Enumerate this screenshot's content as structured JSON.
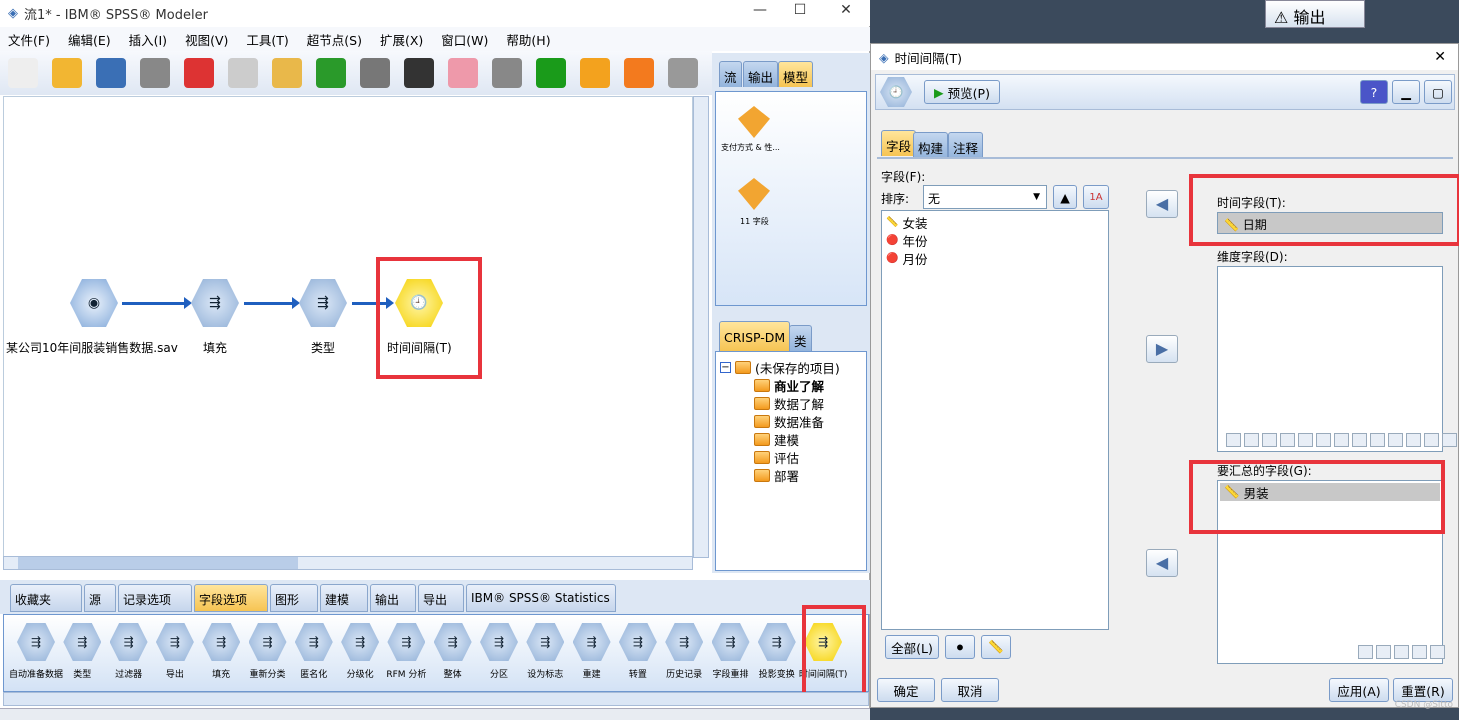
{
  "window": {
    "title": "流1* - IBM® SPSS® Modeler",
    "min": "—",
    "max": "☐",
    "close": "✕"
  },
  "menu": [
    "文件(F)",
    "编辑(E)",
    "插入(I)",
    "视图(V)",
    "工具(T)",
    "超节点(S)",
    "扩展(X)",
    "窗口(W)",
    "帮助(H)"
  ],
  "toolbar_icons": [
    "new-icon",
    "open-icon",
    "save-icon",
    "print-icon",
    "cut-icon",
    "copy-icon",
    "paste-icon",
    "undo-icon",
    "redo-icon",
    "find-icon",
    "edit-icon",
    "stop-icon",
    "run-icon",
    "run-selection-icon",
    "favorite-icon",
    "star-icon"
  ],
  "stream": {
    "nodes": [
      {
        "label": "某公司10年间服装销售数据.sav",
        "icon": "source-icon"
      },
      {
        "label": "填充",
        "icon": "fill-icon"
      },
      {
        "label": "类型",
        "icon": "type-icon"
      },
      {
        "label": "时间间隔(T)",
        "icon": "clock-icon"
      }
    ]
  },
  "manager": {
    "tabs": [
      "流",
      "输出",
      "模型"
    ],
    "active_tab": "模型",
    "models": [
      "支付方式 & 性...",
      "11 字段"
    ]
  },
  "project": {
    "tabs": [
      "CRISP-DM",
      "类"
    ],
    "root": "(未保存的项目)",
    "folders": [
      "商业了解",
      "数据了解",
      "数据准备",
      "建模",
      "评估",
      "部署"
    ]
  },
  "palette": {
    "tabs": [
      "收藏夹",
      "源",
      "记录选项",
      "字段选项",
      "图形",
      "建模",
      "输出",
      "导出",
      "IBM® SPSS® Statistics"
    ],
    "active_tab": "字段选项",
    "items": [
      "自动准备数据",
      "类型",
      "过滤器",
      "导出",
      "填充",
      "重新分类",
      "匿名化",
      "分级化",
      "RFM 分析",
      "整体",
      "分区",
      "设为标志",
      "重建",
      "转置",
      "历史记录",
      "字段重排",
      "投影变换",
      "时间间隔(T)"
    ]
  },
  "dialog": {
    "title": "时间间隔(T)",
    "close": "✕",
    "preview": "预览(P)",
    "tabs": [
      "字段",
      "构建",
      "注释"
    ],
    "active_tab": "字段",
    "fields_label": "字段(F):",
    "sort_label": "排序:",
    "sort_value": "无",
    "fields": [
      {
        "name": "女装",
        "type": "continuous"
      },
      {
        "name": "年份",
        "type": "nominal"
      },
      {
        "name": "月份",
        "type": "nominal"
      }
    ],
    "buttons_left": [
      "全部(L)"
    ],
    "time_field_label": "时间字段(T):",
    "time_field": "日期",
    "dim_label": "维度字段(D):",
    "agg_label": "要汇总的字段(G):",
    "agg_fields": [
      "男装"
    ],
    "ok": "确定",
    "cancel": "取消",
    "apply": "应用(A)",
    "reset": "重置(R)"
  },
  "bg_output_button": "输出",
  "watermark": "CSDN @Sitto",
  "colors": {
    "highlight": "#e8343c",
    "active_tab": "#f6c453",
    "arrow": "#1f5fbf"
  }
}
